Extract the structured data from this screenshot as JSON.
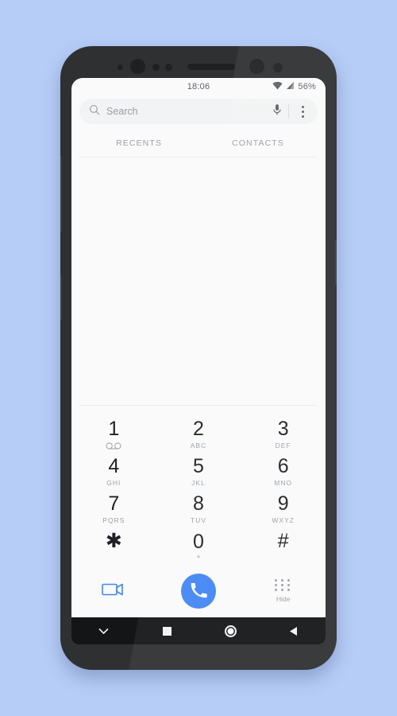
{
  "background": {
    "color": "#b6cdf7"
  },
  "device": {
    "name": "smartphone-mockup",
    "body_color": "#2e3032",
    "hardware": {
      "earpiece": "earpiece-speaker",
      "front_camera": "front-camera",
      "iris_scanner": "iris-scanner",
      "volume_button": "volume-button",
      "bixby_button": "bixby-button",
      "power_button": "power-button"
    }
  },
  "status_bar": {
    "time": "18:06",
    "battery_percent": "56%",
    "wifi_icon": "wifi-icon",
    "signal_icon": "cellular-signal-icon"
  },
  "search": {
    "placeholder": "Search",
    "value": "",
    "search_icon": "search-icon",
    "mic_icon": "microphone-icon",
    "overflow_icon": "overflow-menu-icon"
  },
  "tabs": [
    {
      "label": "RECENTS",
      "id": "recents",
      "selected": true
    },
    {
      "label": "CONTACTS",
      "id": "contacts",
      "selected": false
    }
  ],
  "dialpad": {
    "rows": [
      [
        {
          "digit": "1",
          "sub": "",
          "icon": "voicemail-icon"
        },
        {
          "digit": "2",
          "sub": "ABC",
          "icon": ""
        },
        {
          "digit": "3",
          "sub": "DEF",
          "icon": ""
        }
      ],
      [
        {
          "digit": "4",
          "sub": "GHI",
          "icon": ""
        },
        {
          "digit": "5",
          "sub": "JKL",
          "icon": ""
        },
        {
          "digit": "6",
          "sub": "MNO",
          "icon": ""
        }
      ],
      [
        {
          "digit": "7",
          "sub": "PQRS",
          "icon": ""
        },
        {
          "digit": "8",
          "sub": "TUV",
          "icon": ""
        },
        {
          "digit": "9",
          "sub": "WXYZ",
          "icon": ""
        }
      ],
      [
        {
          "digit": "✱",
          "sub": "",
          "icon": ""
        },
        {
          "digit": "0",
          "sub": "+",
          "icon": ""
        },
        {
          "digit": "#",
          "sub": "",
          "icon": ""
        }
      ]
    ]
  },
  "actions": {
    "video_call_icon": "video-call-icon",
    "video_call_color": "#4285f4",
    "call_icon": "phone-call-icon",
    "call_button_color": "#4285f4",
    "hide_label": "Hide",
    "hide_icon": "dialpad-dots-icon"
  },
  "nav_bar": {
    "items": [
      {
        "id": "hide-keyboard",
        "icon": "chevron-down-icon"
      },
      {
        "id": "recents",
        "icon": "square-icon"
      },
      {
        "id": "home",
        "icon": "circle-icon"
      },
      {
        "id": "back",
        "icon": "triangle-left-icon"
      }
    ]
  }
}
